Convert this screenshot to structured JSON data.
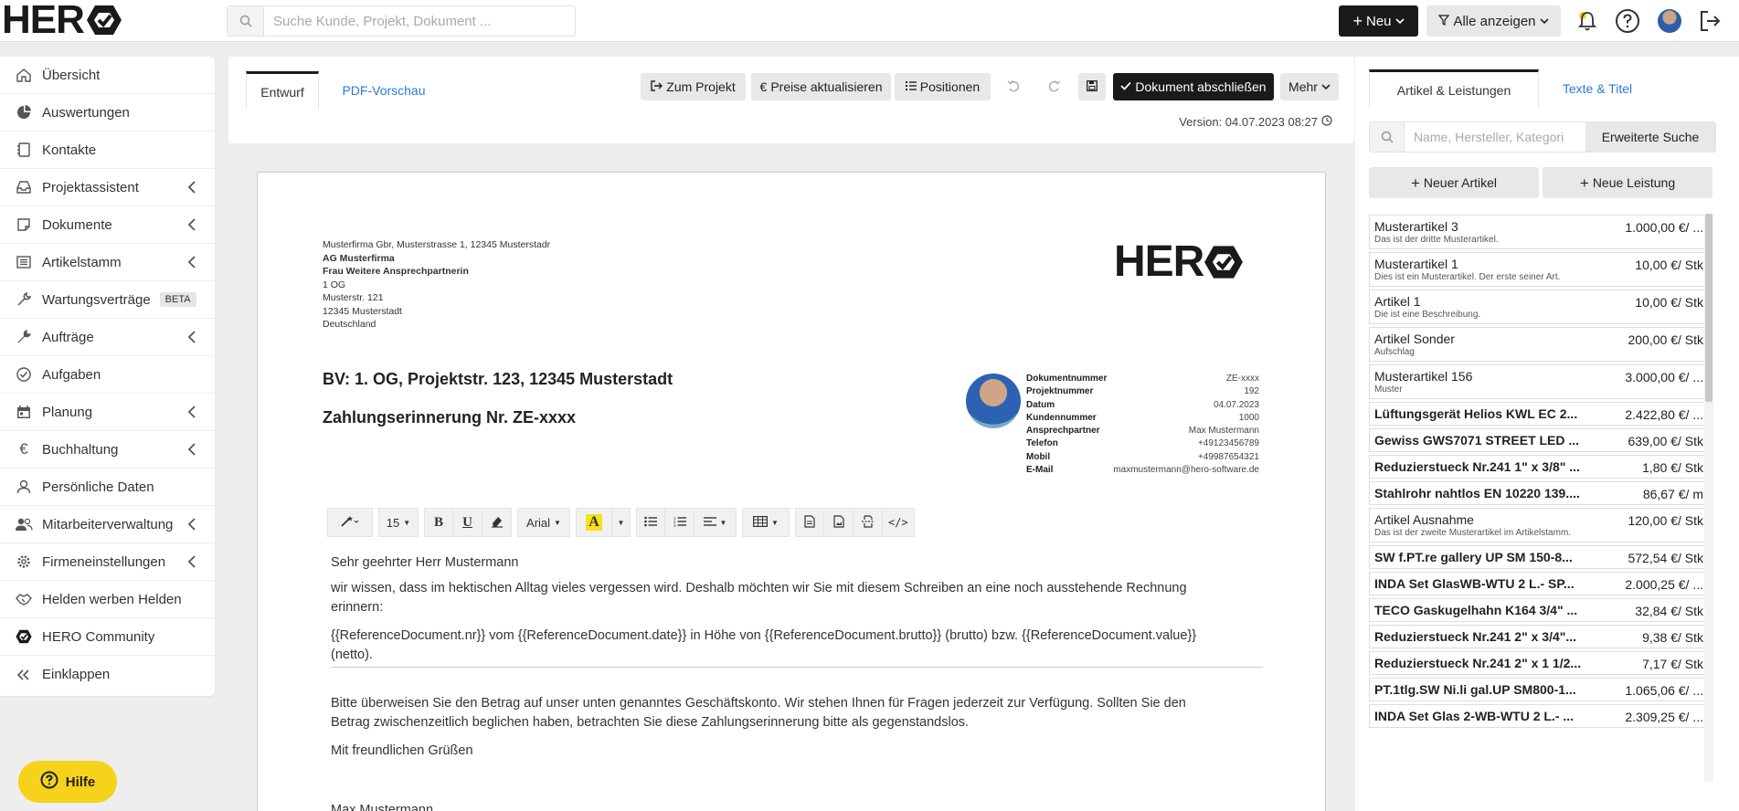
{
  "topbar": {
    "logo_text": "HER",
    "search_placeholder": "Suche Kunde, Projekt, Dokument ...",
    "new_label": "Neu",
    "filter_label": "Alle anzeigen"
  },
  "sidebar": {
    "items": [
      {
        "label": "Übersicht",
        "icon": "home-icon"
      },
      {
        "label": "Auswertungen",
        "icon": "pie-chart-icon"
      },
      {
        "label": "Kontakte",
        "icon": "address-book-icon"
      },
      {
        "label": "Projektassistent",
        "icon": "inbox-icon"
      },
      {
        "label": "Dokumente",
        "icon": "note-icon"
      },
      {
        "label": "Artikelstamm",
        "icon": "list-icon"
      },
      {
        "label": "Wartungsverträge",
        "icon": "wrench-icon",
        "badge": "BETA"
      },
      {
        "label": "Aufträge",
        "icon": "tools-icon"
      },
      {
        "label": "Aufgaben",
        "icon": "check-circle-icon"
      },
      {
        "label": "Planung",
        "icon": "calendar-icon"
      },
      {
        "label": "Buchhaltung",
        "icon": "euro-icon"
      },
      {
        "label": "Persönliche Daten",
        "icon": "user-icon"
      },
      {
        "label": "Mitarbeiterverwaltung",
        "icon": "users-icon"
      },
      {
        "label": "Firmeneinstellungen",
        "icon": "gear-icon"
      },
      {
        "label": "Helden werben Helden",
        "icon": "handshake-icon"
      },
      {
        "label": "HERO Community",
        "icon": "hero-community-icon"
      },
      {
        "label": "Einklappen",
        "icon": "double-chevron-left-icon"
      }
    ],
    "help_label": "Hilfe"
  },
  "editor": {
    "tab_draft": "Entwurf",
    "tab_preview": "PDF-Vorschau",
    "btn_project": "Zum Projekt",
    "btn_prices": "Preise aktualisieren",
    "btn_positions": "Positionen",
    "btn_finish": "Dokument abschließen",
    "btn_more": "Mehr",
    "version": "Version: 04.07.2023 08:27"
  },
  "document": {
    "sender_line": "Musterfirma Gbr, Musterstrasse 1, 12345 Musterstadr",
    "recipient": [
      "AG Musterfirma",
      "Frau Weitere Ansprechpartnerin",
      "1 OG",
      "Musterstr. 121",
      "12345 Musterstadt",
      "Deutschland"
    ],
    "logo_text": "HER",
    "title": "BV: 1. OG, Projektstr. 123, 12345 Musterstadt",
    "subtitle": "Zahlungserinnerung Nr. ZE-xxxx",
    "meta": [
      {
        "k": "Dokumentnummer",
        "v": "ZE-xxxx"
      },
      {
        "k": "Projektnummer",
        "v": "192"
      },
      {
        "k": "Datum",
        "v": "04.07.2023"
      },
      {
        "k": "Kundennummer",
        "v": "1000"
      },
      {
        "k": "Ansprechpartner",
        "v": "Max Mustermann"
      },
      {
        "k": "Telefon",
        "v": "+49123456789"
      },
      {
        "k": "Mobil",
        "v": "+49987654321"
      },
      {
        "k": "E-Mail",
        "v": "maxmustermann@hero-software.de"
      }
    ],
    "toolbar": {
      "font_size": "15",
      "font_family": "Arial"
    },
    "greeting": "Sehr geehrter Herr Mustermann",
    "p1": "wir wissen, dass im hektischen Alltag vieles vergessen wird. Deshalb möchten wir Sie mit diesem Schreiben an eine noch ausstehende Rechnung erinnern:",
    "p2": "{{ReferenceDocument.nr}} vom {{ReferenceDocument.date}} in Höhe von {{ReferenceDocument.brutto}} (brutto) bzw. {{ReferenceDocument.value}} (netto).",
    "p3": "Bitte überweisen Sie den Betrag auf unser unten genanntes Geschäftskonto. Wir stehen Ihnen für Fragen jederzeit zur Verfügung. Sollten Sie den Betrag zwischenzeitlich beglichen haben, betrachten Sie diese Zahlungserinnerung bitte als gegenstandslos.",
    "closing": "Mit freundlichen Grüßen",
    "signature": "Max Mustermann"
  },
  "rpanel": {
    "tab_articles": "Artikel & Leistungen",
    "tab_texts": "Texte & Titel",
    "search_placeholder": "Name, Hersteller, Kategori",
    "ext_search": "Erweiterte Suche",
    "new_article": "Neuer Artikel",
    "new_service": "Neue Leistung",
    "items": [
      {
        "name": "Musterartikel 3",
        "price": "1.000,00 €/ ...",
        "desc": "Das ist der dritte Musterartikel.",
        "bold": false
      },
      {
        "name": "Musterartikel 1",
        "price": "10,00 €/ Stk",
        "desc": "Dies ist ein Musterartikel. Der erste seiner Art.",
        "bold": false
      },
      {
        "name": "Artikel 1",
        "price": "10,00 €/ Stk",
        "desc": "Die ist eine Beschreibung.",
        "bold": false
      },
      {
        "name": "Artikel Sonder",
        "price": "200,00 €/ Stk",
        "desc": "Aufschlag",
        "bold": false
      },
      {
        "name": "Musterartikel 156",
        "price": "3.000,00 €/ ...",
        "desc": "Muster",
        "bold": false
      },
      {
        "name": "Lüftungsgerät Helios KWL EC 2...",
        "price": "2.422,80 €/ ...",
        "desc": "",
        "bold": true
      },
      {
        "name": "Gewiss GWS7071 STREET LED ...",
        "price": "639,00 €/ Stk",
        "desc": "",
        "bold": true
      },
      {
        "name": "Reduzierstueck Nr.241 1\" x 3/8\" ...",
        "price": "1,80 €/ Stk",
        "desc": "",
        "bold": true
      },
      {
        "name": "Stahlrohr nahtlos EN 10220 139....",
        "price": "86,67 €/ m",
        "desc": "",
        "bold": true
      },
      {
        "name": "Artikel Ausnahme",
        "price": "120,00 €/ Stk",
        "desc": "Das ist der zweite Musterartikel im Artikelstamm.",
        "bold": false
      },
      {
        "name": "SW f.PT.re gallery UP SM 150-8...",
        "price": "572,54 €/ Stk",
        "desc": "",
        "bold": true
      },
      {
        "name": "INDA Set GlasWB-WTU 2 L.- SP...",
        "price": "2.000,25 €/ ...",
        "desc": "",
        "bold": true
      },
      {
        "name": "TECO Gaskugelhahn K164 3/4\" ...",
        "price": "32,84 €/ Stk",
        "desc": "",
        "bold": true
      },
      {
        "name": "Reduzierstueck Nr.241 2\" x 3/4\"...",
        "price": "9,38 €/ Stk",
        "desc": "",
        "bold": true
      },
      {
        "name": "Reduzierstueck Nr.241 2\" x 1 1/2...",
        "price": "7,17 €/ Stk",
        "desc": "",
        "bold": true
      },
      {
        "name": "PT.1tlg.SW Ni.li gal.UP SM800-1...",
        "price": "1.065,06 €/ ...",
        "desc": "",
        "bold": true
      },
      {
        "name": "INDA Set Glas 2-WB-WTU 2 L.- ...",
        "price": "2.309,25 €/ ...",
        "desc": "",
        "bold": true
      }
    ]
  },
  "colors": {
    "accent_link": "#2a7ad6",
    "dark_button": "#1a1a1a",
    "help_yellow": "#f7d21b"
  }
}
